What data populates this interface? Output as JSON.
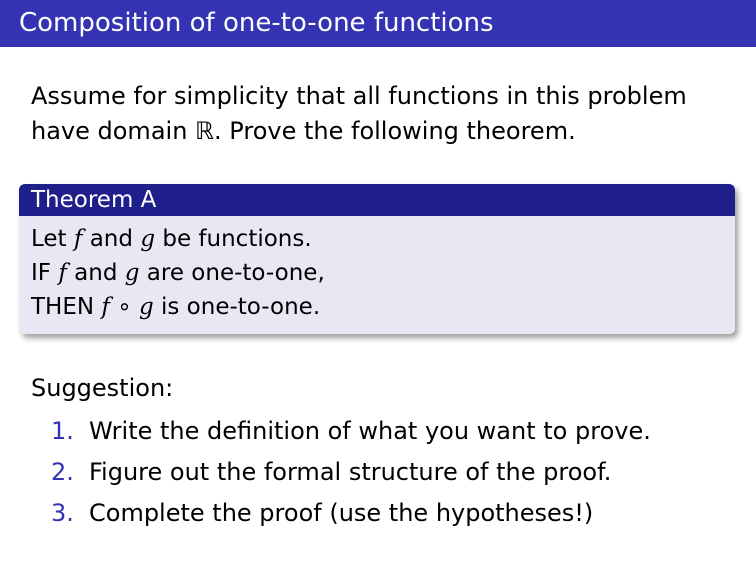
{
  "header": {
    "title": "Composition of one-to-one functions"
  },
  "intro": {
    "line1": "Assume for simplicity that all functions in this problem",
    "line2_prefix": "have domain ",
    "domain_symbol": "ℝ",
    "line2_suffix": ".  Prove the following theorem."
  },
  "theorem": {
    "title": "Theorem A",
    "line1": {
      "t1": "Let ",
      "v1": "f",
      "t2": " and ",
      "v2": "g",
      "t3": " be functions."
    },
    "line2": {
      "t1": "IF ",
      "v1": "f",
      "t2": " and ",
      "v2": "g",
      "t3": " are one-to-one,"
    },
    "line3": {
      "t1": "THEN ",
      "v1": "f",
      "op": " ∘ ",
      "v2": "g",
      "t3": " is one-to-one."
    }
  },
  "suggestion": {
    "label": "Suggestion:",
    "steps": [
      {
        "num": "1.",
        "text": "Write the definition of what you want to prove."
      },
      {
        "num": "2.",
        "text": "Figure out the formal structure of the proof."
      },
      {
        "num": "3.",
        "text": "Complete the proof (use the hypotheses!)"
      }
    ]
  },
  "colors": {
    "header_bg": "#3333b3",
    "block_title_bg": "#1f1f8c",
    "block_body_bg": "#e8e8f5",
    "enum_number": "#3333b3"
  }
}
